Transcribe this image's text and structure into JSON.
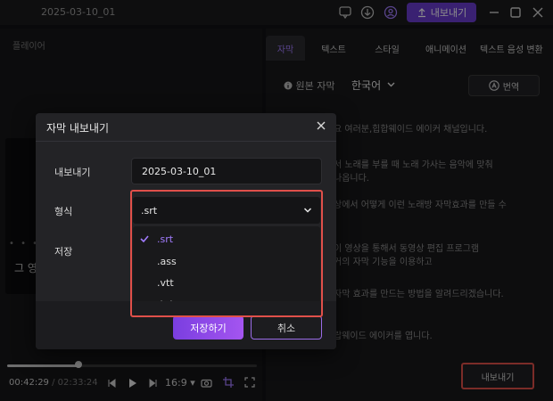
{
  "titlebar": {
    "project_date": "2025-03-10_01",
    "export_label": "내보내기",
    "icons": [
      "chat-icon",
      "download-icon",
      "account-icon",
      "minimize-icon",
      "maximize-icon",
      "close-icon"
    ]
  },
  "player": {
    "label": "플레이어",
    "subtitle_preview": "그 영",
    "current_time": "00:42:29",
    "total_time": "/ 02:33:24",
    "aspect": "16:9",
    "progress": 0.29
  },
  "right_panel": {
    "tabs": [
      "자막",
      "텍스트",
      "스타일",
      "애니메이션",
      "텍스트 음성 변환"
    ],
    "active_tab": "자막",
    "source_label": "원본 자막",
    "language": "한국어",
    "translate_label": "번역",
    "subtitle_lines": [
      "요 여러분,힙합웨이드 에이커 채널입니다.",
      "서 노래를 부를 때 노래 가사는 음악에 맞춰",
      "나옵니다.",
      "상에서 어떻게 이런 노래방 자막효과를 만들 수",
      "이 영상을 통해서 동영상 편집 프로그램",
      "커의 자막 기능을 이용하고",
      "자막 효과를 만드는 방법을 알려드리겠습니다.",
      "랍웨이드 에이커를 엽니다."
    ],
    "export_button": "내보내기"
  },
  "dialog": {
    "title": "자막 내보내기",
    "export_label": "내보내기",
    "filename": "2025-03-10_01",
    "format_label": "형식",
    "format_selected": ".srt",
    "save_label": "저장",
    "format_options": [
      ".srt",
      ".ass",
      ".vtt",
      ".txt"
    ],
    "save_button": "저장하기",
    "cancel_button": "취소"
  },
  "colors": {
    "accent": "#a27cff",
    "primary_button": "#7a3ee0",
    "highlight_box": "#e0504a"
  }
}
